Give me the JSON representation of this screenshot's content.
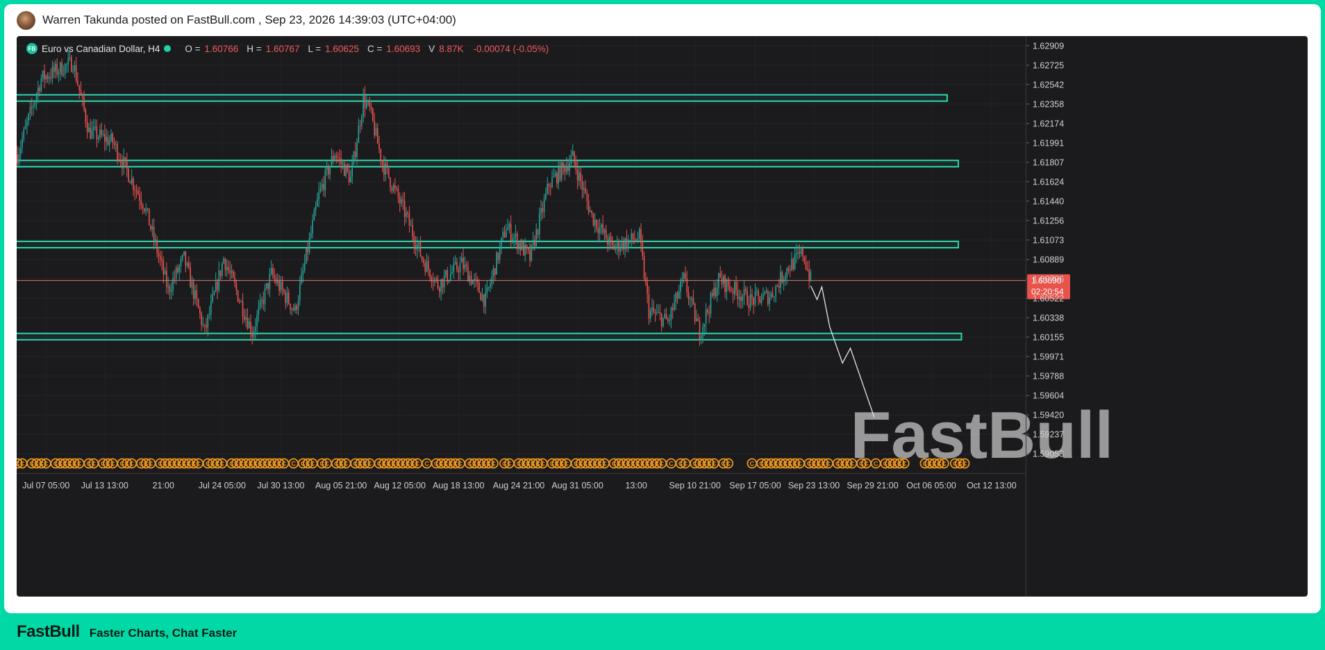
{
  "post": {
    "author": "Warren Takunda",
    "text": "Warren Takunda posted on FastBull.com ,  Sep 23, 2026 14:39:03 (UTC+04:00)"
  },
  "legend": {
    "badge": "FB",
    "symbol": "Euro vs Canadian Dollar, H4",
    "o_label": "O =",
    "o": "1.60766",
    "h_label": "H =",
    "h": "1.60767",
    "l_label": "L =",
    "l": "1.60625",
    "c_label": "C =",
    "c": "1.60693",
    "v_label": "V",
    "v": "8.87K",
    "change": "-0.00074 (-0.05%)"
  },
  "price_tag": {
    "price": "1.60690",
    "countdown": "02:20:54"
  },
  "watermark": "FastBull",
  "footer": {
    "logo": "FastBull",
    "tagline": "Faster Charts, Chat Faster"
  },
  "colors": {
    "background": "#1b1b1e",
    "up": "#26a69a",
    "down": "#ef5350",
    "zone": "#2bd8b0",
    "brand": "#00d9a6",
    "event": "#f29a1a"
  },
  "event_icon": "C",
  "chart_data": {
    "type": "candlestick",
    "title": "Euro vs Canadian Dollar, H4",
    "ylim": [
      1.5887,
      1.63
    ],
    "y_ticks": [
      "1.62909",
      "1.62725",
      "1.62542",
      "1.62358",
      "1.62174",
      "1.61991",
      "1.61807",
      "1.61624",
      "1.61440",
      "1.61256",
      "1.61073",
      "1.60889",
      "1.60706",
      "1.60522",
      "1.60338",
      "1.60155",
      "1.59971",
      "1.59788",
      "1.59604",
      "1.59420",
      "1.59237",
      "1.59053"
    ],
    "x_ticks": [
      "Jul 07 05:00",
      "Jul 13 13:00",
      "21:00",
      "Jul 24 05:00",
      "Jul 30 13:00",
      "Aug 05 21:00",
      "Aug 12 05:00",
      "Aug 18 13:00",
      "Aug 24 21:00",
      "Aug 31 05:00",
      "13:00",
      "Sep 10 21:00",
      "Sep 17 05:00",
      "Sep 23 13:00",
      "Sep 29 21:00",
      "Oct 06 05:00",
      "Oct 12 13:00"
    ],
    "x_tick_index": [
      18,
      55,
      92,
      129,
      166,
      204,
      241,
      278,
      316,
      353,
      390,
      427,
      465,
      502,
      539,
      576,
      614
    ],
    "last_index": 500,
    "total_slots": 636,
    "current_price": 1.6069,
    "zones": [
      {
        "low": 1.62385,
        "high": 1.62445,
        "start_index": 0,
        "end_index": 586
      },
      {
        "low": 1.61765,
        "high": 1.61825,
        "start_index": 0,
        "end_index": 593
      },
      {
        "low": 1.61,
        "high": 1.6106,
        "start_index": 0,
        "end_index": 593
      },
      {
        "low": 1.6013,
        "high": 1.6019,
        "start_index": 0,
        "end_index": 595
      }
    ],
    "projection": [
      [
        500,
        1.6064
      ],
      [
        504,
        1.6051
      ],
      [
        507,
        1.6063
      ],
      [
        512,
        1.6025
      ],
      [
        520,
        1.5991
      ],
      [
        525,
        1.6005
      ],
      [
        540,
        1.594
      ]
    ],
    "pivots": [
      [
        0,
        1.6188
      ],
      [
        15,
        1.626
      ],
      [
        35,
        1.6275
      ],
      [
        45,
        1.621
      ],
      [
        60,
        1.62
      ],
      [
        80,
        1.614
      ],
      [
        95,
        1.606
      ],
      [
        105,
        1.609
      ],
      [
        118,
        1.602
      ],
      [
        130,
        1.609
      ],
      [
        148,
        1.602
      ],
      [
        160,
        1.6075
      ],
      [
        175,
        1.604
      ],
      [
        190,
        1.615
      ],
      [
        200,
        1.619
      ],
      [
        210,
        1.6165
      ],
      [
        218,
        1.624
      ],
      [
        222,
        1.623
      ],
      [
        230,
        1.618
      ],
      [
        245,
        1.613
      ],
      [
        255,
        1.609
      ],
      [
        265,
        1.6065
      ],
      [
        280,
        1.6085
      ],
      [
        295,
        1.605
      ],
      [
        308,
        1.612
      ],
      [
        323,
        1.609
      ],
      [
        335,
        1.616
      ],
      [
        350,
        1.6185
      ],
      [
        362,
        1.613
      ],
      [
        375,
        1.61
      ],
      [
        392,
        1.611
      ],
      [
        398,
        1.604
      ],
      [
        410,
        1.603
      ],
      [
        420,
        1.607
      ],
      [
        430,
        1.602
      ],
      [
        442,
        1.607
      ],
      [
        452,
        1.606
      ],
      [
        462,
        1.605
      ],
      [
        475,
        1.6055
      ],
      [
        485,
        1.608
      ],
      [
        495,
        1.6095
      ],
      [
        500,
        1.60693
      ]
    ]
  }
}
